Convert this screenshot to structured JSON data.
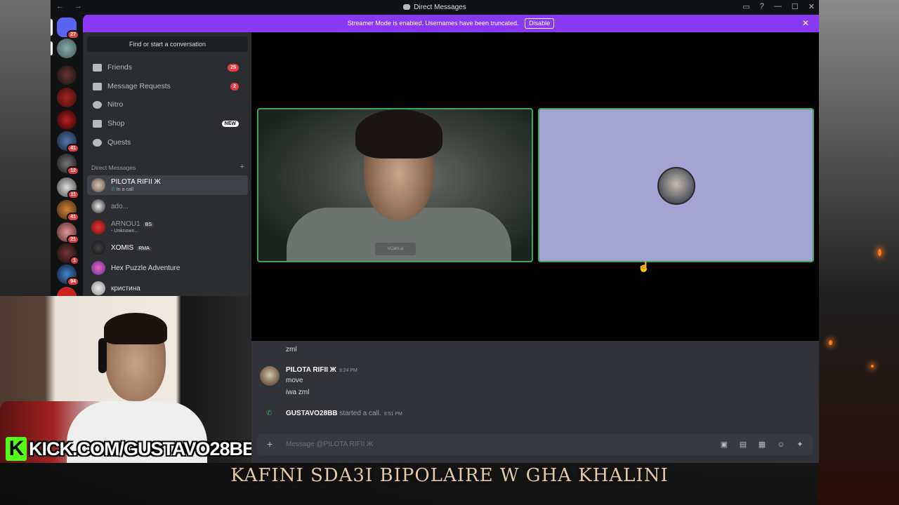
{
  "window": {
    "title": "Direct Messages",
    "nav_arrows": "← →",
    "controls": [
      "▭",
      "?",
      "—",
      "☐",
      "✕"
    ]
  },
  "server_rail": {
    "badges": [
      "27",
      "41",
      "12",
      "11",
      "41",
      "21",
      "1",
      "94"
    ],
    "colors": {
      "discord": "#5865f2",
      "badge": "#e43f40"
    }
  },
  "streamer": {
    "message": "Streamer Mode is enabled. Usernames have been truncated.",
    "button": "Disable",
    "close": "✕",
    "color": "#8b38f5"
  },
  "sidebar": {
    "search": "Find or start a conversation",
    "nav": [
      {
        "label": "Friends",
        "count": "25"
      },
      {
        "label": "Message Requests",
        "count": "2"
      },
      {
        "label": "Nitro"
      },
      {
        "label": "Shop",
        "badge": "NEW"
      },
      {
        "label": "Quests"
      }
    ],
    "dm_header": "Direct Messages",
    "dm_add": "+",
    "dms": [
      {
        "name": "PILOTA RIFII Ж",
        "status": "In a call",
        "selected": true
      },
      {
        "name": "ado..."
      },
      {
        "name": "ARNOU1",
        "tag": "BS",
        "status": "- Unknown..."
      },
      {
        "name": "XOMIS",
        "tag": "RMA"
      },
      {
        "name": "Hex Puzzle Adventure"
      },
      {
        "name": "кристина"
      }
    ]
  },
  "call": {
    "watermark": "VCam.ai",
    "speaking_color": "#3ba55d",
    "avatar_tile_color": "#a5a2d4"
  },
  "chat": {
    "messages": [
      {
        "text": "zml"
      },
      {
        "author": "PILOTA RIFII Ж",
        "time": "9:24 PM",
        "lines": [
          "move",
          "iwa zml"
        ]
      },
      {
        "author": "GUSTAVO28BB",
        "action": "started a call.",
        "time": "9:51 PM"
      }
    ],
    "composer_placeholder": "Message @PILOTA RIFII Ж",
    "composer_tools": [
      "gift-icon",
      "gif-icon",
      "sticker-icon",
      "emoji-icon",
      "apps-icon"
    ]
  },
  "overlay": {
    "kick_logo": "K",
    "kick_url": "KICK.COM/GUSTAVO28BB",
    "caption": "KAFINI SDA3I BIPOLAIRE W GHA KHALINI",
    "kick_color": "#53fc18"
  }
}
